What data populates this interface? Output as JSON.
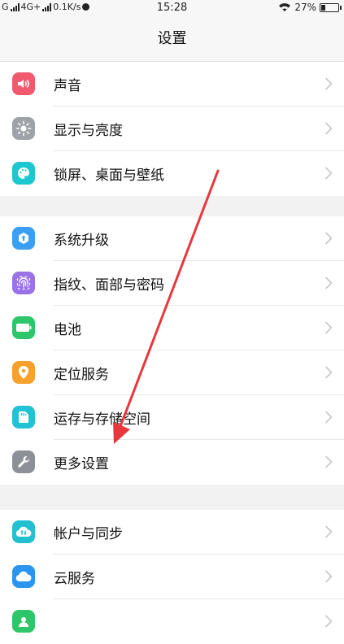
{
  "status_bar": {
    "carrier": "G",
    "network": "4G+",
    "speed": "0.1K/s",
    "time": "15:28",
    "battery_text": "27%",
    "battery_level": 0.27
  },
  "header": {
    "title": "设置"
  },
  "groups": [
    {
      "items": [
        {
          "label": "声音",
          "icon": "speaker-icon",
          "color": "#f05a6e"
        },
        {
          "label": "显示与亮度",
          "icon": "brightness-icon",
          "color": "#9ea3aa"
        },
        {
          "label": "锁屏、桌面与壁纸",
          "icon": "palette-icon",
          "color": "#1cc7d0"
        }
      ]
    },
    {
      "items": [
        {
          "label": "系统升级",
          "icon": "upgrade-icon",
          "color": "#3a9ff2"
        },
        {
          "label": "指纹、面部与密码",
          "icon": "fingerprint-icon",
          "color": "#9a72e8"
        },
        {
          "label": "电池",
          "icon": "battery-icon",
          "color": "#2dc66a"
        },
        {
          "label": "定位服务",
          "icon": "location-icon",
          "color": "#f5a12c"
        },
        {
          "label": "运存与存储空间",
          "icon": "storage-icon",
          "color": "#21c2d6"
        },
        {
          "label": "更多设置",
          "icon": "wrench-icon",
          "color": "#8d9096"
        }
      ]
    },
    {
      "items": [
        {
          "label": "帐户与同步",
          "icon": "account-sync-icon",
          "color": "#22c0d0"
        },
        {
          "label": "云服务",
          "icon": "cloud-icon",
          "color": "#2b95ef"
        },
        {
          "label": "",
          "icon": "contacts-icon",
          "color": "#2dc66a"
        }
      ]
    }
  ]
}
